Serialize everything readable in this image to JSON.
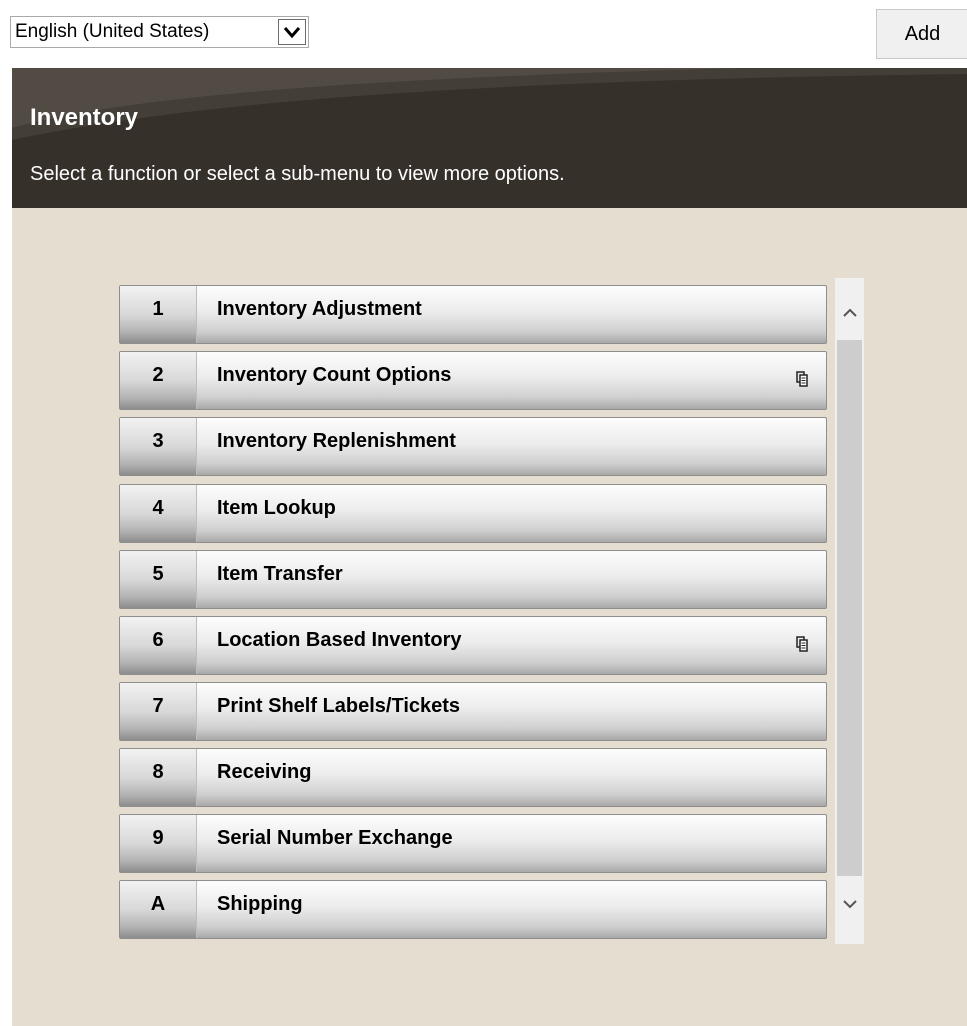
{
  "language_select": {
    "selected": "English (United States)"
  },
  "toolbar": {
    "add_label": "Add"
  },
  "header": {
    "title": "Inventory",
    "subtitle": "Select a function or select a sub-menu to view more options."
  },
  "menu": {
    "items": [
      {
        "key": "1",
        "label": "Inventory Adjustment",
        "has_submenu": false
      },
      {
        "key": "2",
        "label": "Inventory Count Options",
        "has_submenu": true
      },
      {
        "key": "3",
        "label": "Inventory Replenishment",
        "has_submenu": false
      },
      {
        "key": "4",
        "label": "Item Lookup",
        "has_submenu": false
      },
      {
        "key": "5",
        "label": "Item Transfer",
        "has_submenu": false
      },
      {
        "key": "6",
        "label": "Location Based Inventory",
        "has_submenu": true
      },
      {
        "key": "7",
        "label": "Print Shelf Labels/Tickets",
        "has_submenu": false
      },
      {
        "key": "8",
        "label": "Receiving",
        "has_submenu": false
      },
      {
        "key": "9",
        "label": "Serial Number Exchange",
        "has_submenu": false
      },
      {
        "key": "A",
        "label": "Shipping",
        "has_submenu": false
      }
    ]
  },
  "icons": {
    "dropdown": "chevron-down-icon",
    "submenu": "submenu-icon",
    "scroll_up": "chevron-up-icon",
    "scroll_down": "chevron-down-icon"
  },
  "colors": {
    "header_bg": "#35302a",
    "content_bg": "#e4ddd0",
    "header_text": "#ffffff"
  }
}
